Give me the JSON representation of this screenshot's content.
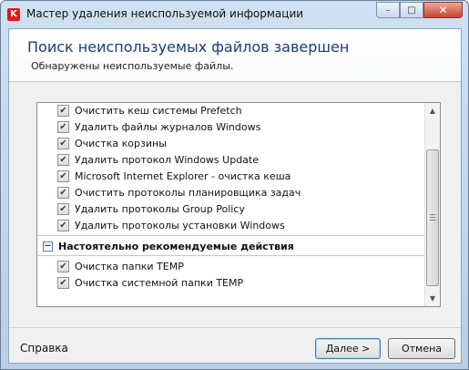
{
  "window": {
    "title": "Мастер удаления неиспользуемой информации",
    "app_icon_letter": "K",
    "controls": {
      "minimize": "–",
      "maximize": "□",
      "close": "✕"
    }
  },
  "header": {
    "title": "Поиск неиспользуемых файлов завершен",
    "subtitle": "Обнаружены неиспользуемые файлы."
  },
  "list": {
    "items_before": [
      {
        "label": "Очистить кеш системы Prefetch",
        "checked": true
      },
      {
        "label": "Удалить файлы журналов Windows",
        "checked": true
      },
      {
        "label": "Очистка корзины",
        "checked": true
      },
      {
        "label": "Удалить протокол Windows Update",
        "checked": true
      },
      {
        "label": "Microsoft Internet Explorer - очистка кеша",
        "checked": true
      },
      {
        "label": "Очистить протоколы планировщика задач",
        "checked": true
      },
      {
        "label": "Удалить протоколы Group Policy",
        "checked": true
      },
      {
        "label": "Удалить протоколы установки Windows",
        "checked": true
      }
    ],
    "group": {
      "label": "Настоятельно рекомендуемые действия",
      "toggle": "–"
    },
    "items_after": [
      {
        "label": "Очистка папки TEMP",
        "checked": true
      },
      {
        "label": "Очистка системной папки TEMP",
        "checked": true
      }
    ],
    "check_glyph": "✔"
  },
  "footer": {
    "help_label": "Справка",
    "next_label": "Далее >",
    "cancel_label": "Отмена"
  }
}
